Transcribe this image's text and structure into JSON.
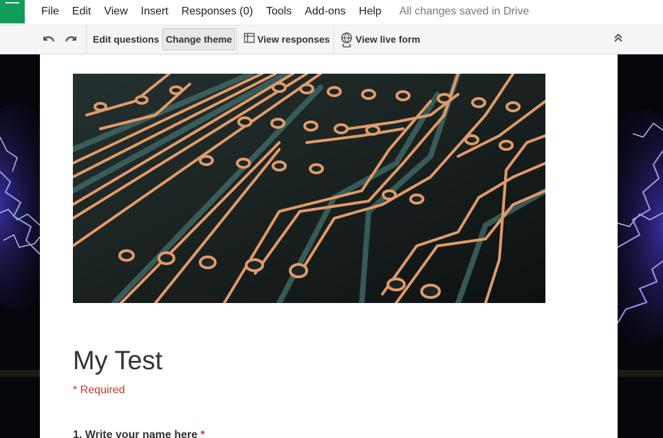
{
  "menu": {
    "items": [
      "File",
      "Edit",
      "View",
      "Insert",
      "Responses (0)",
      "Tools",
      "Add-ons",
      "Help"
    ],
    "save_status": "All changes saved in Drive"
  },
  "toolbar": {
    "undo_icon": "undo-icon",
    "redo_icon": "redo-icon",
    "edit_questions": "Edit questions",
    "change_theme": "Change theme",
    "view_responses": "View responses",
    "view_live_form": "View live form",
    "collapse_icon": "double-chevron-up-icon"
  },
  "colors": {
    "app_green": "#0f9d58",
    "required_red": "#c53929",
    "toolbar_bg": "#f5f5f5"
  },
  "form": {
    "title": "My Test",
    "required_note": "* Required",
    "questions": [
      {
        "number": "1.",
        "text": "Write your name here",
        "required_mark": "*"
      }
    ]
  }
}
